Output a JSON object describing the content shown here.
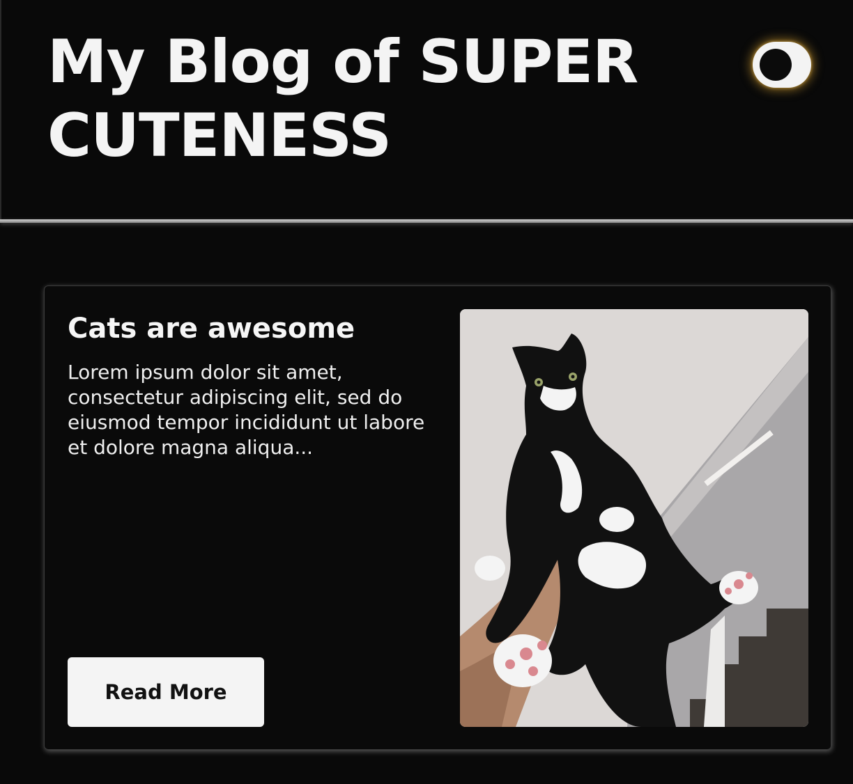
{
  "header": {
    "title": "My Blog of SUPER CUTENESS",
    "theme_toggle_state": "dark",
    "toggle_glow_color": "#d6a032"
  },
  "post": {
    "title": "Cats are awesome",
    "excerpt": "Lorem ipsum dolor sit amet, consectetur adipiscing elit, sed do eiusmod tempor incididunt ut labore et dolore magna aliqua...",
    "read_more_label": "Read More",
    "image_subject": "black-and-white-cat-photo"
  },
  "colors": {
    "background": "#090909",
    "text": "#f4f4f4",
    "button_bg": "#f4f4f4",
    "button_text": "#111111"
  }
}
